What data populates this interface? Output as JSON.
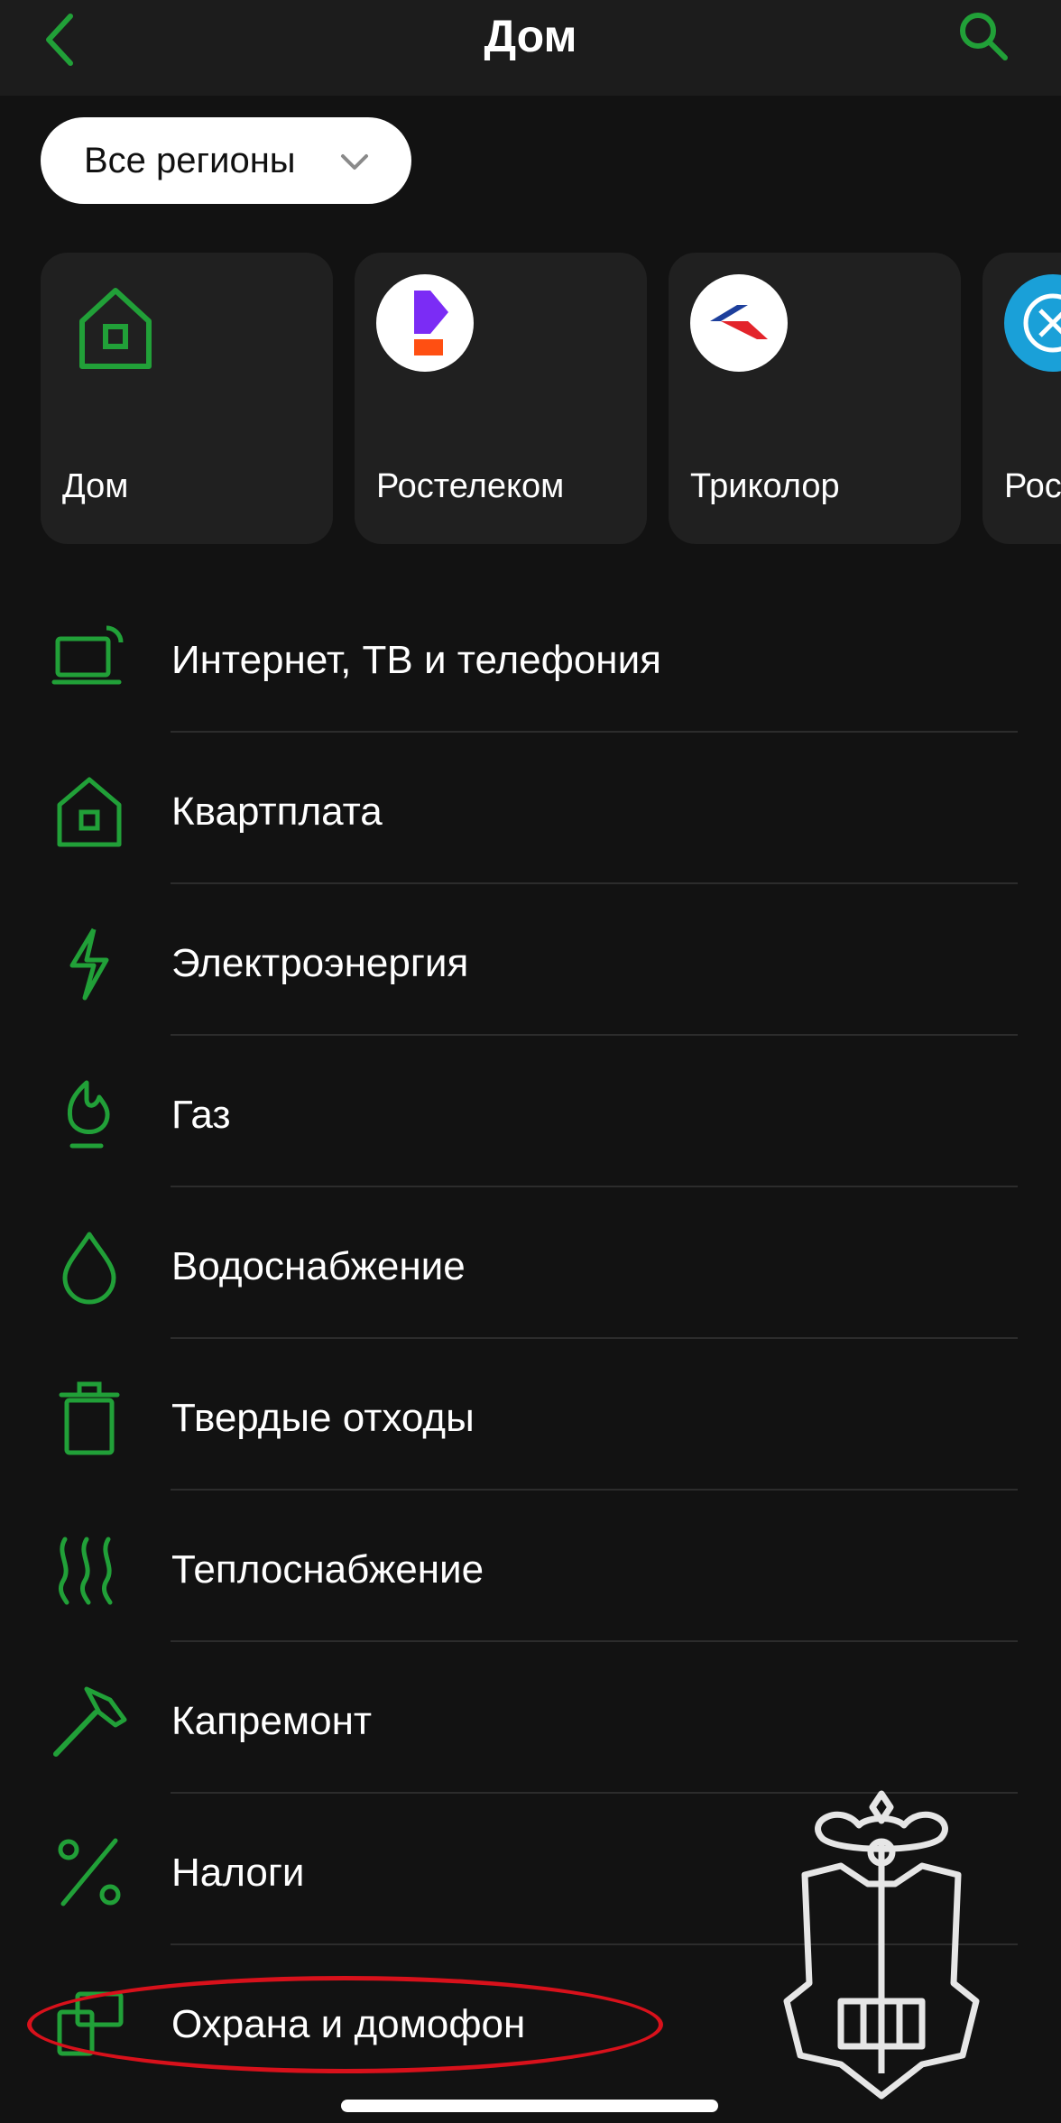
{
  "header": {
    "title": "Дом",
    "back_icon": "chevron-left-icon",
    "search_icon": "search-icon"
  },
  "region_filter": {
    "label": "Все регионы",
    "icon": "chevron-down-icon"
  },
  "quick_cards": [
    {
      "label": "Дом",
      "icon": "house-icon"
    },
    {
      "label": "Ростелеком",
      "icon": "rostelecom-logo"
    },
    {
      "label": "Триколор",
      "icon": "tricolor-logo"
    },
    {
      "label": "Рос",
      "icon": "emblem-logo"
    }
  ],
  "categories": [
    {
      "label": "Интернет, ТВ и телефония",
      "icon": "laptop-wifi-icon"
    },
    {
      "label": "Квартплата",
      "icon": "house-icon"
    },
    {
      "label": "Электроэнергия",
      "icon": "lightning-icon"
    },
    {
      "label": "Газ",
      "icon": "flame-icon"
    },
    {
      "label": "Водоснабжение",
      "icon": "water-drop-icon"
    },
    {
      "label": "Твердые отходы",
      "icon": "trash-bin-icon"
    },
    {
      "label": "Теплоснабжение",
      "icon": "heat-waves-icon"
    },
    {
      "label": "Капремонт",
      "icon": "hammer-icon"
    },
    {
      "label": "Налоги",
      "icon": "percent-icon"
    },
    {
      "label": "Охрана и домофон",
      "icon": "intercom-icon"
    }
  ],
  "colors": {
    "accent": "#21a038",
    "background": "#121212",
    "card": "#202020",
    "highlight": "#d8111b"
  }
}
